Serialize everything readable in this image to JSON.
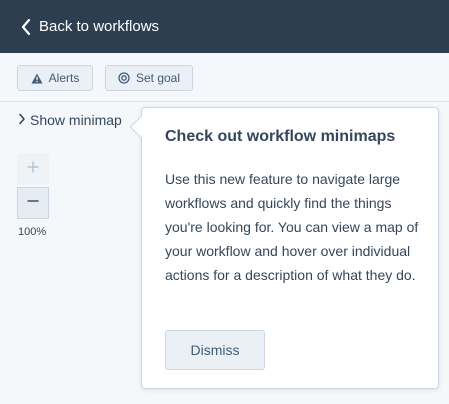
{
  "header": {
    "back_label": "Back to workflows",
    "back_icon": "chevron-left-icon"
  },
  "toolbar": {
    "alerts_label": "Alerts",
    "alerts_icon": "warning-triangle-icon",
    "goal_label": "Set goal",
    "goal_icon": "target-icon"
  },
  "canvas": {
    "minimap_label": "Show minimap",
    "minimap_icon": "chevron-right-icon",
    "zoom_in_icon": "plus-icon",
    "zoom_out_icon": "minus-icon",
    "zoom_level": "100%"
  },
  "popover": {
    "title": "Check out workflow minimaps",
    "body": "Use this new feature to navigate large workflows and quickly find the things you're looking for. You can view a map of your workflow and hover over individual actions for a description of what they do.",
    "dismiss_label": "Dismiss"
  },
  "colors": {
    "header_bg": "#2d3e50",
    "canvas_bg": "#f5f8fa",
    "button_bg": "#eaf0f6",
    "border": "#cbd6e2",
    "text": "#33475b"
  }
}
